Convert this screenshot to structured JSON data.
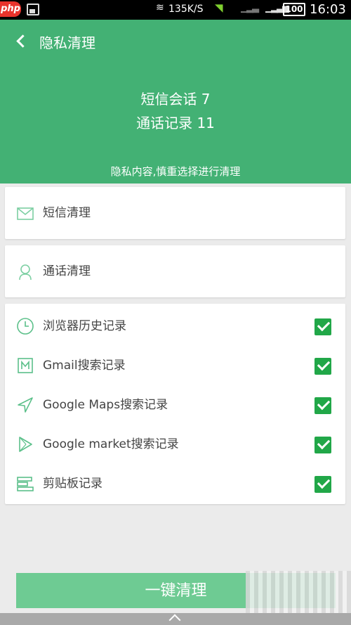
{
  "status_bar": {
    "app_badge": "php",
    "speed": "135K/S",
    "battery": "100",
    "time": "16:03"
  },
  "header": {
    "title": "隐私清理",
    "sms_summary": "短信会话 7",
    "call_summary": "通话记录 11",
    "hint": "隐私内容,慎重选择进行清理"
  },
  "cards": {
    "sms_label": "短信清理",
    "calls_label": "通话清理"
  },
  "items": [
    {
      "label": "浏览器历史记录",
      "icon": "clock-icon",
      "checked": true
    },
    {
      "label": "Gmail搜索记录",
      "icon": "gmail-icon",
      "checked": true
    },
    {
      "label": "Google Maps搜索记录",
      "icon": "navigation-arrow-icon",
      "checked": true
    },
    {
      "label": "Google market搜索记录",
      "icon": "play-icon",
      "checked": true
    },
    {
      "label": "剪贴板记录",
      "icon": "clipboard-lines-icon",
      "checked": true
    }
  ],
  "action": {
    "clean_button": "一键清理"
  },
  "colors": {
    "header": "#43b174",
    "checkbox": "#21a748",
    "button": "#6ecb93",
    "icon": "#5cc08a"
  }
}
